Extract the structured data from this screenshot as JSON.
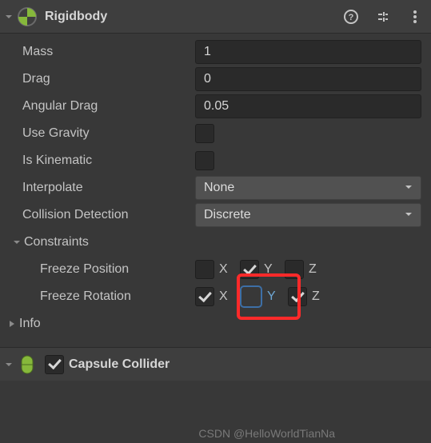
{
  "rigidbody": {
    "title": "Rigidbody",
    "mass": {
      "label": "Mass",
      "value": "1"
    },
    "drag": {
      "label": "Drag",
      "value": "0"
    },
    "angularDrag": {
      "label": "Angular Drag",
      "value": "0.05"
    },
    "useGravity": {
      "label": "Use Gravity",
      "checked": false
    },
    "isKinematic": {
      "label": "Is Kinematic",
      "checked": false
    },
    "interpolate": {
      "label": "Interpolate",
      "value": "None"
    },
    "collisionDetection": {
      "label": "Collision Detection",
      "value": "Discrete"
    },
    "constraints": {
      "label": "Constraints",
      "freezePosition": {
        "label": "Freeze Position",
        "x": {
          "label": "X",
          "checked": false
        },
        "y": {
          "label": "Y",
          "checked": true
        },
        "z": {
          "label": "Z",
          "checked": false
        }
      },
      "freezeRotation": {
        "label": "Freeze Rotation",
        "x": {
          "label": "X",
          "checked": true
        },
        "y": {
          "label": "Y",
          "checked": false
        },
        "z": {
          "label": "Z",
          "checked": true
        }
      }
    },
    "info": {
      "label": "Info"
    }
  },
  "capsuleCollider": {
    "title": "Capsule Collider",
    "enabled": true
  },
  "watermark": "CSDN @HelloWorldTianNa"
}
